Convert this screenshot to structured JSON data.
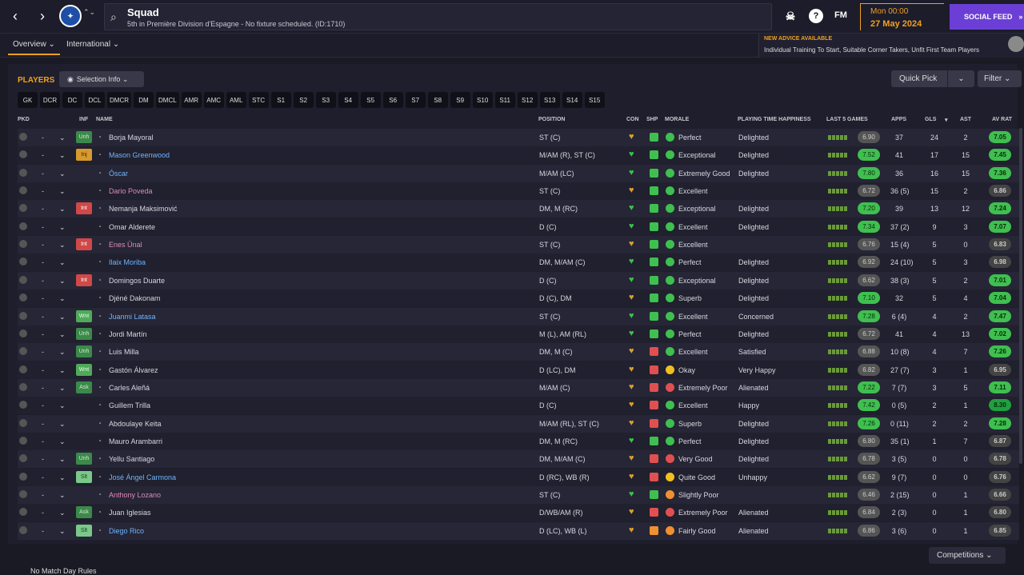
{
  "header": {
    "title": "Squad",
    "subtitle": "5th in Première Division d'Espagne - No fixture scheduled. (ID:1710)",
    "time": "Mon 00:00",
    "date": "27 May 2024",
    "social": "SOCIAL FEED",
    "fm": "FM",
    "back": "‹",
    "forward": "›",
    "updown": "⌃⌄"
  },
  "subnav": {
    "overview": "Overview ⌄",
    "international": "International ⌄"
  },
  "advice": {
    "heading": "NEW ADVICE AVAILABLE",
    "message": "Individual Training To Start, Suitable Corner Takers, Unfit First Team Players"
  },
  "toolbar": {
    "title": "PLAYERS",
    "selection": "Selection Info ⌄",
    "quickpick": "Quick Pick",
    "quickpick_arrow": "⌄",
    "filter": "Filter ⌄"
  },
  "positions": [
    "GK",
    "DCR",
    "DC",
    "DCL",
    "DMCR",
    "DM",
    "DMCL",
    "AMR",
    "AMC",
    "AML",
    "STC",
    "S1",
    "S2",
    "S3",
    "S4",
    "S5",
    "S6",
    "S7",
    "S8",
    "S9",
    "S10",
    "S11",
    "S12",
    "S13",
    "S14",
    "S15"
  ],
  "columns": {
    "pkd": "PKD",
    "inf": "INF",
    "name": "NAME",
    "position": "POSITION",
    "con": "CON",
    "shp": "SHP",
    "morale": "MORALE",
    "pth": "PLAYING TIME HAPPINESS",
    "last5": "LAST 5 GAMES",
    "apps": "APPS",
    "gls": "GLS",
    "sort": "▾",
    "ast": "AST",
    "avrat": "AV RAT"
  },
  "players": [
    {
      "inf": "Unh",
      "infc": "unh",
      "name": "Borja Mayoral",
      "nc": "",
      "pos": "ST (C)",
      "morale": "Perfect",
      "mc": "#3fbf4f",
      "shp": "#3fbf4f",
      "pth": "Delighted",
      "r5": "6.90",
      "r5c": "#555",
      "apps": "37",
      "gls": "24",
      "ast": "2",
      "avr": "7.05",
      "avc": "#3fbf4f"
    },
    {
      "inf": "Inj",
      "infc": "inj",
      "name": "Mason Greenwood",
      "nc": "blue",
      "pos": "M/AM (R), ST (C)",
      "morale": "Exceptional",
      "mc": "#3fbf4f",
      "shp": "#3fbf4f",
      "pth": "Delighted",
      "r5": "7.52",
      "r5c": "#3fbf4f",
      "apps": "41",
      "gls": "17",
      "ast": "15",
      "avr": "7.45",
      "avc": "#3fbf4f"
    },
    {
      "inf": "",
      "infc": "",
      "name": "Óscar",
      "nc": "blue",
      "pos": "M/AM (LC)",
      "morale": "Extremely Good",
      "mc": "#3fbf4f",
      "shp": "#3fbf4f",
      "pth": "Delighted",
      "r5": "7.80",
      "r5c": "#3fbf4f",
      "apps": "36",
      "gls": "16",
      "ast": "15",
      "avr": "7.36",
      "avc": "#3fbf4f"
    },
    {
      "inf": "",
      "infc": "",
      "name": "Dario Poveda",
      "nc": "pink",
      "pos": "ST (C)",
      "morale": "Excellent",
      "mc": "#3fbf4f",
      "shp": "#3fbf4f",
      "pth": "",
      "r5": "6.72",
      "r5c": "#555",
      "apps": "36 (5)",
      "gls": "15",
      "ast": "2",
      "avr": "6.86",
      "avc": "#444"
    },
    {
      "inf": "Int",
      "infc": "int",
      "name": "Nemanja Maksimović",
      "nc": "",
      "pos": "DM, M (RC)",
      "morale": "Exceptional",
      "mc": "#3fbf4f",
      "shp": "#3fbf4f",
      "pth": "Delighted",
      "r5": "7.20",
      "r5c": "#3fbf4f",
      "apps": "39",
      "gls": "13",
      "ast": "12",
      "avr": "7.24",
      "avc": "#3fbf4f"
    },
    {
      "inf": "",
      "infc": "",
      "name": "Omar Alderete",
      "nc": "",
      "pos": "D (C)",
      "morale": "Excellent",
      "mc": "#3fbf4f",
      "shp": "#3fbf4f",
      "pth": "Delighted",
      "r5": "7.34",
      "r5c": "#3fbf4f",
      "apps": "37 (2)",
      "gls": "9",
      "ast": "3",
      "avr": "7.07",
      "avc": "#3fbf4f"
    },
    {
      "inf": "Int",
      "infc": "int",
      "name": "Enes Ünal",
      "nc": "pink",
      "pos": "ST (C)",
      "morale": "Excellent",
      "mc": "#3fbf4f",
      "shp": "#3fbf4f",
      "pth": "",
      "r5": "6.76",
      "r5c": "#555",
      "apps": "15 (4)",
      "gls": "5",
      "ast": "0",
      "avr": "6.83",
      "avc": "#444"
    },
    {
      "inf": "",
      "infc": "",
      "name": "Ilaix Moriba",
      "nc": "blue",
      "pos": "DM, M/AM (C)",
      "morale": "Perfect",
      "mc": "#3fbf4f",
      "shp": "#3fbf4f",
      "pth": "Delighted",
      "r5": "6.92",
      "r5c": "#555",
      "apps": "24 (10)",
      "gls": "5",
      "ast": "3",
      "avr": "6.98",
      "avc": "#444"
    },
    {
      "inf": "Int",
      "infc": "int",
      "name": "Domingos Duarte",
      "nc": "",
      "pos": "D (C)",
      "morale": "Exceptional",
      "mc": "#3fbf4f",
      "shp": "#3fbf4f",
      "pth": "Delighted",
      "r5": "6.62",
      "r5c": "#555",
      "apps": "38 (3)",
      "gls": "5",
      "ast": "2",
      "avr": "7.01",
      "avc": "#3fbf4f"
    },
    {
      "inf": "",
      "infc": "",
      "name": "Djéné Dakonam",
      "nc": "",
      "pos": "D (C), DM",
      "morale": "Superb",
      "mc": "#3fbf4f",
      "shp": "#3fbf4f",
      "pth": "Delighted",
      "r5": "7.10",
      "r5c": "#3fbf4f",
      "apps": "32",
      "gls": "5",
      "ast": "4",
      "avr": "7.04",
      "avc": "#3fbf4f"
    },
    {
      "inf": "Wnt",
      "infc": "wnt",
      "name": "Juanmi Latasa",
      "nc": "blue",
      "pos": "ST (C)",
      "morale": "Excellent",
      "mc": "#3fbf4f",
      "shp": "#3fbf4f",
      "pth": "Concerned",
      "r5": "7.28",
      "r5c": "#3fbf4f",
      "apps": "6 (4)",
      "gls": "4",
      "ast": "2",
      "avr": "7.47",
      "avc": "#3fbf4f"
    },
    {
      "inf": "Unh",
      "infc": "unh",
      "name": "Jordi Martín",
      "nc": "",
      "pos": "M (L), AM (RL)",
      "morale": "Perfect",
      "mc": "#3fbf4f",
      "shp": "#3fbf4f",
      "pth": "Delighted",
      "r5": "6.72",
      "r5c": "#555",
      "apps": "41",
      "gls": "4",
      "ast": "13",
      "avr": "7.02",
      "avc": "#3fbf4f"
    },
    {
      "inf": "Unh",
      "infc": "unh",
      "name": "Luis Milla",
      "nc": "",
      "pos": "DM, M (C)",
      "morale": "Excellent",
      "mc": "#3fbf4f",
      "shp": "#e05050",
      "pth": "Satisfied",
      "r5": "6.88",
      "r5c": "#555",
      "apps": "10 (8)",
      "gls": "4",
      "ast": "7",
      "avr": "7.26",
      "avc": "#3fbf4f"
    },
    {
      "inf": "Wnt",
      "infc": "wnt",
      "name": "Gastón Álvarez",
      "nc": "",
      "pos": "D (LC), DM",
      "morale": "Okay",
      "mc": "#f0c020",
      "shp": "#e05050",
      "pth": "Very Happy",
      "r5": "6.82",
      "r5c": "#555",
      "apps": "27 (7)",
      "gls": "3",
      "ast": "1",
      "avr": "6.95",
      "avc": "#444"
    },
    {
      "inf": "Ask",
      "infc": "ask",
      "name": "Carles Aleñá",
      "nc": "",
      "pos": "M/AM (C)",
      "morale": "Extremely Poor",
      "mc": "#e05050",
      "shp": "#e05050",
      "pth": "Alienated",
      "r5": "7.22",
      "r5c": "#3fbf4f",
      "apps": "7 (7)",
      "gls": "3",
      "ast": "5",
      "avr": "7.11",
      "avc": "#3fbf4f"
    },
    {
      "inf": "",
      "infc": "",
      "name": "Guillem Trilla",
      "nc": "",
      "pos": "D (C)",
      "morale": "Excellent",
      "mc": "#3fbf4f",
      "shp": "#e05050",
      "pth": "Happy",
      "r5": "7.42",
      "r5c": "#3fbf4f",
      "apps": "0 (5)",
      "gls": "2",
      "ast": "1",
      "avr": "8.30",
      "avc": "#1fa03f"
    },
    {
      "inf": "",
      "infc": "",
      "name": "Abdoulaye Keita",
      "nc": "",
      "pos": "M/AM (RL), ST (C)",
      "morale": "Superb",
      "mc": "#3fbf4f",
      "shp": "#e05050",
      "pth": "Delighted",
      "r5": "7.26",
      "r5c": "#3fbf4f",
      "apps": "0 (11)",
      "gls": "2",
      "ast": "2",
      "avr": "7.28",
      "avc": "#3fbf4f"
    },
    {
      "inf": "",
      "infc": "",
      "name": "Mauro Arambarri",
      "nc": "",
      "pos": "DM, M (RC)",
      "morale": "Perfect",
      "mc": "#3fbf4f",
      "shp": "#3fbf4f",
      "pth": "Delighted",
      "r5": "6.80",
      "r5c": "#555",
      "apps": "35 (1)",
      "gls": "1",
      "ast": "7",
      "avr": "6.87",
      "avc": "#444"
    },
    {
      "inf": "Unh",
      "infc": "unh",
      "name": "Yellu Santiago",
      "nc": "",
      "pos": "DM, M/AM (C)",
      "morale": "Very Good",
      "mc": "#e05050",
      "shp": "#e05050",
      "pth": "Delighted",
      "r5": "6.78",
      "r5c": "#555",
      "apps": "3 (5)",
      "gls": "0",
      "ast": "0",
      "avr": "6.78",
      "avc": "#444"
    },
    {
      "inf": "Slt",
      "infc": "slt",
      "name": "José Ángel Carmona",
      "nc": "blue",
      "pos": "D (RC), WB (R)",
      "morale": "Quite Good",
      "mc": "#f0c020",
      "shp": "#e05050",
      "pth": "Unhappy",
      "r5": "6.62",
      "r5c": "#555",
      "apps": "9 (7)",
      "gls": "0",
      "ast": "0",
      "avr": "6.76",
      "avc": "#444"
    },
    {
      "inf": "",
      "infc": "",
      "name": "Anthony Lozano",
      "nc": "pink",
      "pos": "ST (C)",
      "morale": "Slightly Poor",
      "mc": "#f09030",
      "shp": "#3fbf4f",
      "pth": "",
      "r5": "6.46",
      "r5c": "#555",
      "apps": "2 (15)",
      "gls": "0",
      "ast": "1",
      "avr": "6.66",
      "avc": "#444"
    },
    {
      "inf": "Ask",
      "infc": "ask",
      "name": "Juan Iglesias",
      "nc": "",
      "pos": "D/WB/AM (R)",
      "morale": "Extremely Poor",
      "mc": "#e05050",
      "shp": "#e05050",
      "pth": "Alienated",
      "r5": "6.84",
      "r5c": "#555",
      "apps": "2 (3)",
      "gls": "0",
      "ast": "1",
      "avr": "6.80",
      "avc": "#444"
    },
    {
      "inf": "Slt",
      "infc": "slt",
      "name": "Diego Rico",
      "nc": "blue",
      "pos": "D (LC), WB (L)",
      "morale": "Fairly Good",
      "mc": "#f09030",
      "shp": "#f09030",
      "pth": "Alienated",
      "r5": "6.86",
      "r5c": "#555",
      "apps": "3 (6)",
      "gls": "0",
      "ast": "1",
      "avr": "6.85",
      "avc": "#444"
    }
  ],
  "footer": {
    "competitions": "Competitions ⌄",
    "nomatch": "No Match Day Rules"
  }
}
